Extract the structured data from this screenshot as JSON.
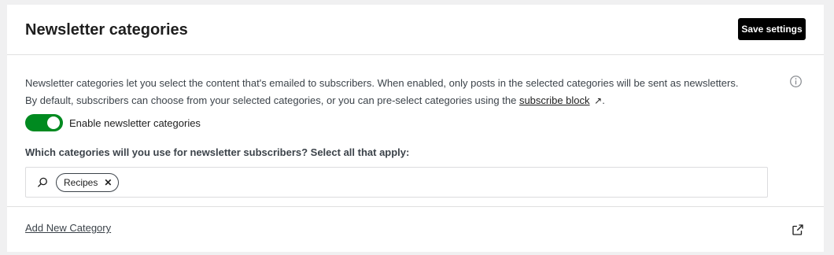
{
  "header": {
    "title": "Newsletter categories",
    "save_label": "Save settings"
  },
  "description": {
    "text": "Newsletter categories let you select the content that's emailed to subscribers. When enabled, only posts in the selected categories will be sent as newsletters. By default, subscribers can choose from your selected categories, or you can pre-select categories using the ",
    "link_label": "subscribe block",
    "link_suffix": "↗",
    "end_punctuation": "."
  },
  "toggle": {
    "label": "Enable newsletter categories",
    "enabled": true
  },
  "categories": {
    "question": "Which categories will you use for newsletter subscribers? Select all that apply:",
    "selected": [
      {
        "label": "Recipes",
        "remove_glyph": "✕"
      }
    ],
    "search_value": ""
  },
  "footer": {
    "add_label": "Add New Category"
  },
  "icons": {
    "info": "info-icon",
    "search": "search-icon",
    "external": "external-link-icon"
  },
  "colors": {
    "toggle_on": "#008a20",
    "button_bg": "#000000"
  }
}
